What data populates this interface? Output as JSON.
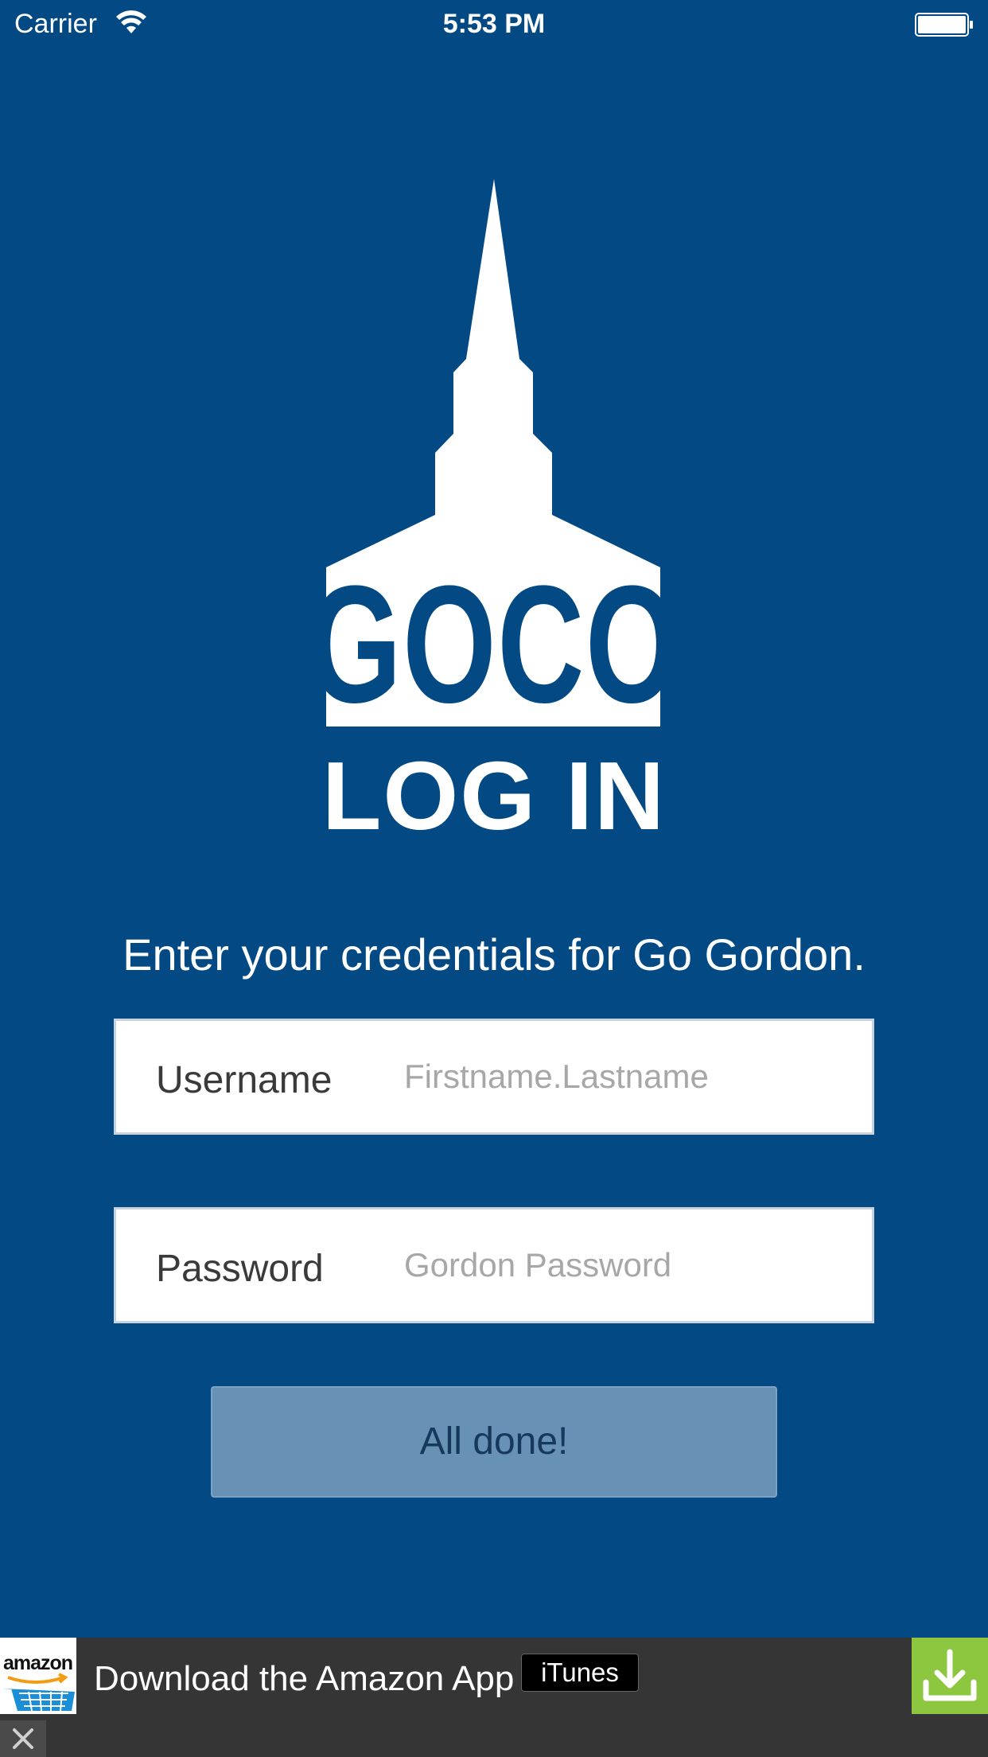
{
  "status_bar": {
    "carrier": "Carrier",
    "time": "5:53 PM",
    "icons": [
      "wifi-icon",
      "battery-icon"
    ]
  },
  "logo": {
    "text": "GOCO",
    "icon": "chapel-steeple-logo"
  },
  "page": {
    "title": "LOG IN",
    "instructions": "Enter your credentials for Go Gordon."
  },
  "form": {
    "username": {
      "label": "Username",
      "placeholder": "Firstname.Lastname",
      "value": ""
    },
    "password": {
      "label": "Password",
      "placeholder": "Gordon Password",
      "value": ""
    },
    "submit_label": "All done!"
  },
  "ad": {
    "brand": "amazon",
    "text": "Download the Amazon App",
    "badge": "iTunes",
    "icons": [
      "amazon-cart-icon",
      "download-icon",
      "close-icon"
    ]
  },
  "colors": {
    "background": "#034a84",
    "button": "#6791b5",
    "ad_background": "#353535",
    "download_green": "#8dc63f"
  }
}
